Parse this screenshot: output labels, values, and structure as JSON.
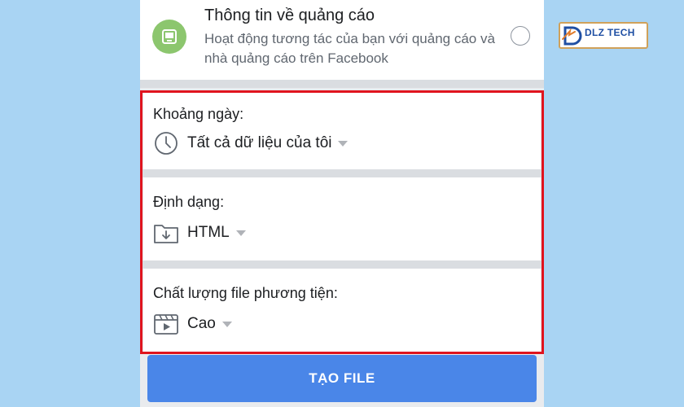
{
  "ad_info": {
    "title": "Thông tin về quảng cáo",
    "description": "Hoạt động tương tác của bạn với quảng cáo và nhà quảng cáo trên Facebook"
  },
  "date_range": {
    "label": "Khoảng ngày:",
    "value": "Tất cả dữ liệu của tôi",
    "icon": "clock-icon"
  },
  "format": {
    "label": "Định dạng:",
    "value": "HTML",
    "icon": "folder-download-icon"
  },
  "media_quality": {
    "label": "Chất lượng file phương tiện:",
    "value": "Cao",
    "icon": "video-clapper-icon"
  },
  "create_button": {
    "label": "TẠO FILE"
  },
  "watermark": {
    "brand": "DLZ TECH"
  },
  "colors": {
    "background": "#a9d4f3",
    "button": "#4a86e8",
    "highlight_border": "#e0141e",
    "ad_icon": "#8cc66e"
  }
}
